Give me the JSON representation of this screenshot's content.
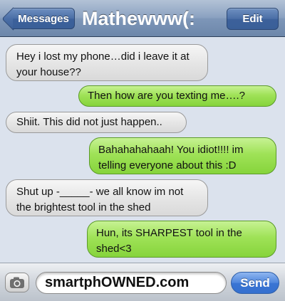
{
  "navbar": {
    "back_label": "Messages",
    "title": "Mathewww(:",
    "edit_label": "Edit"
  },
  "messages": [
    {
      "direction": "incoming",
      "text": "Hey i lost my phone…did i leave it at your house??"
    },
    {
      "direction": "outgoing",
      "text": "Then how are you texting me….?"
    },
    {
      "direction": "incoming",
      "text": "Shiit. This did not just happen.."
    },
    {
      "direction": "outgoing",
      "text": "Bahahahahaah! You idiot!!!! im telling everyone about this :D"
    },
    {
      "direction": "incoming",
      "text": "Shut up -_____- we all know im not the  brightest tool in the shed"
    },
    {
      "direction": "outgoing",
      "text": "Hun, its SHARPEST tool in the shed<3"
    }
  ],
  "input": {
    "value": "smartphOWNED.com",
    "send_label": "Send",
    "camera_icon": "camera-icon"
  },
  "colors": {
    "incoming_bubble": "#e6e6e6",
    "outgoing_bubble": "#9fe257",
    "navbar": "#7d96b8",
    "send_button": "#3a75d4"
  }
}
